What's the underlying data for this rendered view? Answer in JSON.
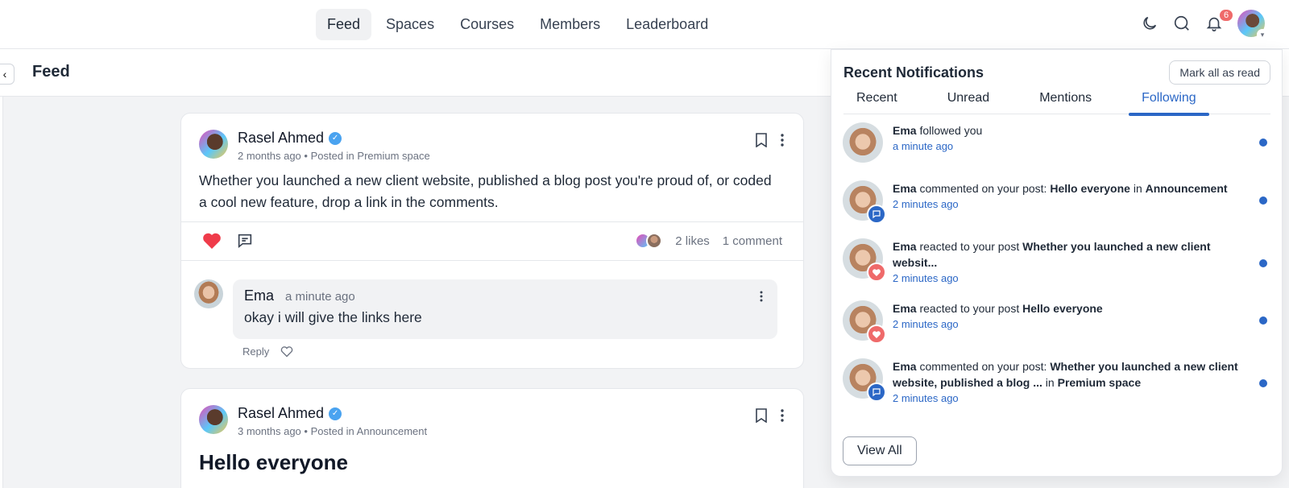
{
  "nav": {
    "items": [
      {
        "label": "Feed",
        "active": true
      },
      {
        "label": "Spaces",
        "active": false
      },
      {
        "label": "Courses",
        "active": false
      },
      {
        "label": "Members",
        "active": false
      },
      {
        "label": "Leaderboard",
        "active": false
      }
    ],
    "notification_count": "6"
  },
  "page": {
    "title": "Feed"
  },
  "posts": [
    {
      "author": "Rasel Ahmed",
      "time": "2 months ago",
      "posted_in": "Posted in Premium space",
      "body": "Whether you launched a new client website, published a blog post you're proud of, or coded a cool new feature, drop a link in the comments.",
      "likes": "2 likes",
      "comments": "1 comment",
      "comment": {
        "author": "Ema",
        "time": "a minute ago",
        "text": "okay i will give the links here",
        "reply_label": "Reply"
      }
    },
    {
      "author": "Rasel Ahmed",
      "time": "3 months ago",
      "posted_in": "Posted in Announcement",
      "title": "Hello everyone"
    }
  ],
  "notifications": {
    "title": "Recent Notifications",
    "mark_all": "Mark all as read",
    "tabs": [
      "Recent",
      "Unread",
      "Mentions",
      "Following"
    ],
    "active_tab": "Following",
    "view_all": "View All",
    "items": [
      {
        "actor": "Ema",
        "pre": " followed you",
        "bold": "",
        "mid": "",
        "bold2": "",
        "time": "a minute ago",
        "type": "none"
      },
      {
        "actor": "Ema",
        "pre": " commented on your post: ",
        "bold": "Hello everyone",
        "mid": " in ",
        "bold2": "Announcement",
        "time": "2 minutes ago",
        "type": "comment"
      },
      {
        "actor": "Ema",
        "pre": " reacted to your post ",
        "bold": "Whether you launched a new client websit...",
        "mid": "",
        "bold2": "",
        "time": "2 minutes ago",
        "type": "heart"
      },
      {
        "actor": "Ema",
        "pre": " reacted to your post ",
        "bold": "Hello everyone",
        "mid": "",
        "bold2": "",
        "time": "2 minutes ago",
        "type": "heart"
      },
      {
        "actor": "Ema",
        "pre": " commented on your post: ",
        "bold": "Whether you launched a new client website, published a blog ...",
        "mid": " in ",
        "bold2": "Premium space",
        "time": "2 minutes ago",
        "type": "comment"
      }
    ]
  },
  "colors": {
    "accent": "#2b67c6",
    "badge": "#ef6a6a",
    "heart": "#ef3b4a",
    "verified": "#4aa3f0"
  }
}
